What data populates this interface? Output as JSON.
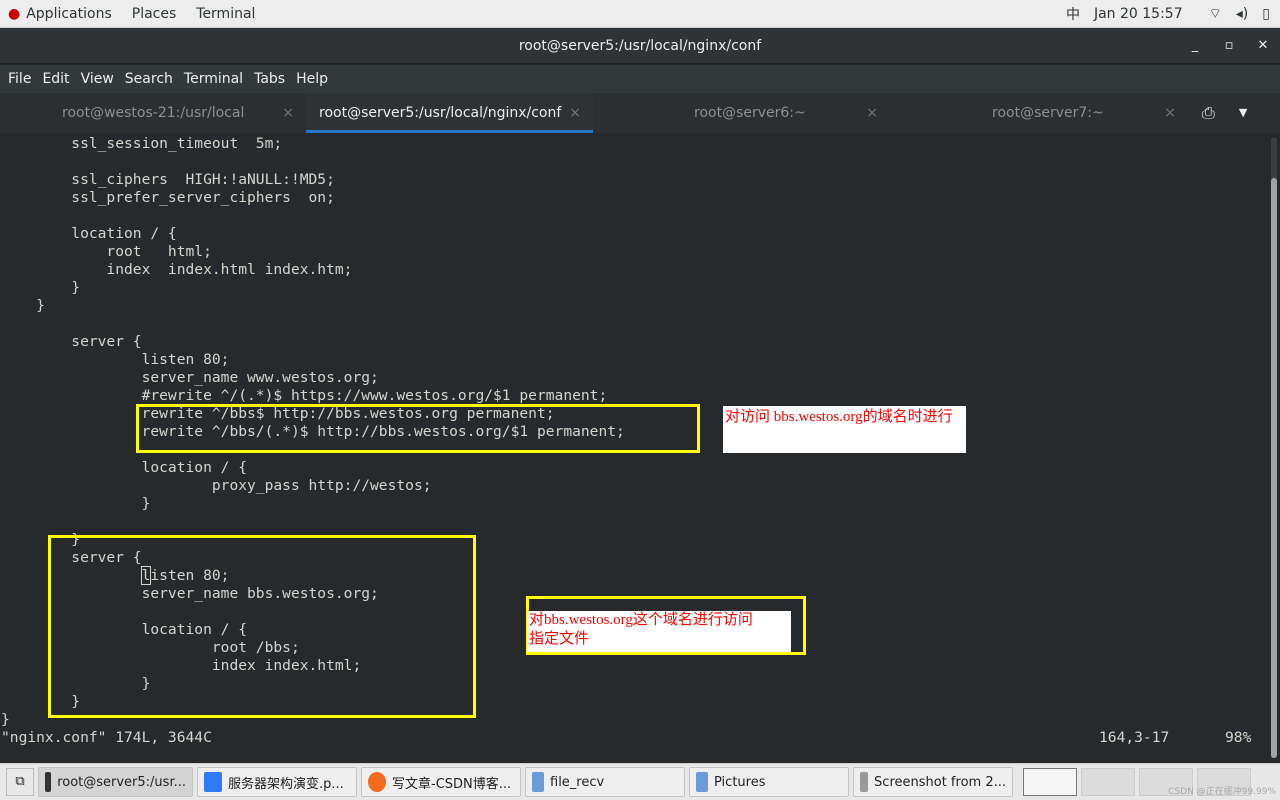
{
  "topbar": {
    "applications": "Applications",
    "places": "Places",
    "terminal": "Terminal",
    "input_method": "中",
    "datetime": "Jan 20  15:57"
  },
  "window": {
    "title": "root@server5:/usr/local/nginx/conf",
    "minimize": "_",
    "maximize": "▫",
    "close": "✕"
  },
  "menu": [
    "File",
    "Edit",
    "View",
    "Search",
    "Terminal",
    "Tabs",
    "Help"
  ],
  "tabs": [
    {
      "label": "root@westos-21:/usr/local"
    },
    {
      "label": "root@server5:/usr/local/nginx/conf",
      "active": true
    },
    {
      "label": "root@server6:~"
    },
    {
      "label": "root@server7:~"
    }
  ],
  "tab_close": "×",
  "lines": [
    "        ssl_session_timeout  5m;",
    "",
    "        ssl_ciphers  HIGH:!aNULL:!MD5;",
    "        ssl_prefer_server_ciphers  on;",
    "",
    "        location / {",
    "            root   html;",
    "            index  index.html index.htm;",
    "        }",
    "    }",
    "",
    "        server {",
    "                listen 80;",
    "                server_name www.westos.org;",
    "                #rewrite ^/(.*)$ https://www.westos.org/$1 permanent;",
    "                rewrite ^/bbs$ http://bbs.westos.org permanent;",
    "                rewrite ^/bbs/(.*)$ http://bbs.westos.org/$1 permanent;",
    "",
    "                location / {",
    "                        proxy_pass http://westos;",
    "                }",
    "",
    "        }",
    "        server {",
    "                listen 80;",
    "                server_name bbs.westos.org;",
    "",
    "                location / {",
    "                        root /bbs;",
    "                        index index.html;",
    "                }",
    "        }",
    "}"
  ],
  "status": {
    "file": "\"nginx.conf\" 174L, 3644C",
    "position": "164,3-17",
    "percent": "98%"
  },
  "annotations": {
    "note1": "对访问  bbs.westos.org的域名时进行",
    "note2_line1": "对bbs.westos.org这个域名进行访问",
    "note2_line2": "指定文件"
  },
  "taskbar": [
    {
      "label": "root@server5:/usr..."
    },
    {
      "label": "服务器架构演变.p..."
    },
    {
      "label": "写文章-CSDN博客..."
    },
    {
      "label": "file_recv"
    },
    {
      "label": "Pictures"
    },
    {
      "label": "Screenshot from 2..."
    }
  ],
  "watermark": "CSDN @正在缓冲99.99%"
}
